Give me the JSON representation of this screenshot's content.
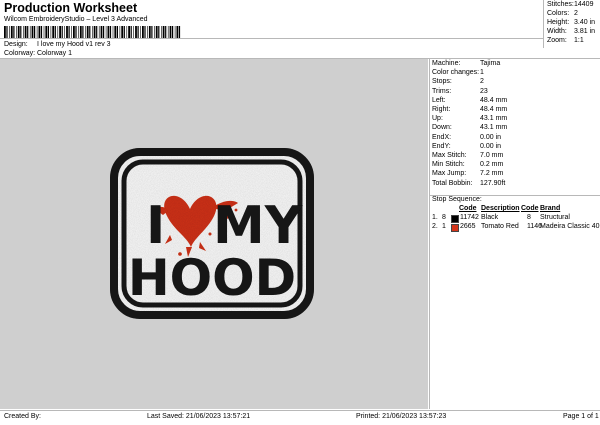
{
  "header": {
    "title": "Production Worksheet",
    "subtitle": "Wilcom EmbroideryStudio – Level 3 Advanced",
    "design_label": "Design:",
    "design_value": "I love my Hood v1 rev 3",
    "colorway_label": "Colorway:",
    "colorway_value": "Colorway 1"
  },
  "stats": [
    {
      "label": "Stitches:",
      "value": "14409"
    },
    {
      "label": "Colors:",
      "value": "2"
    },
    {
      "label": "Height:",
      "value": "3.40 in"
    },
    {
      "label": "Width:",
      "value": "3.81 in"
    },
    {
      "label": "Zoom:",
      "value": "1:1"
    }
  ],
  "machine_info": [
    {
      "label": "Machine:",
      "value": "Tajima"
    },
    {
      "label": "Color changes:",
      "value": "1"
    },
    {
      "label": "Stops:",
      "value": "2"
    },
    {
      "label": "Trims:",
      "value": "23"
    },
    {
      "label": "Left:",
      "value": "48.4 mm"
    },
    {
      "label": "Right:",
      "value": "48.4 mm"
    },
    {
      "label": "Up:",
      "value": "43.1 mm"
    },
    {
      "label": "Down:",
      "value": "43.1 mm"
    },
    {
      "label": "EndX:",
      "value": "0.00 in"
    },
    {
      "label": "EndY:",
      "value": "0.00 in"
    },
    {
      "label": "Max Stitch:",
      "value": "7.0 mm"
    },
    {
      "label": "Min Stitch:",
      "value": "0.2 mm"
    },
    {
      "label": "Max Jump:",
      "value": "7.2 mm"
    },
    {
      "label": "Total Bobbin:",
      "value": "127.90ft"
    }
  ],
  "stop_sequence": {
    "title": "Stop Sequence:",
    "columns": [
      "Code",
      "Description",
      "Code",
      "Brand"
    ],
    "rows": [
      {
        "num": "1.",
        "stop": "8",
        "color": "#000000",
        "code": "11742",
        "description": "Black",
        "brand_code": "8",
        "brand": "Structural"
      },
      {
        "num": "2.",
        "stop": "1",
        "color": "#d4341a",
        "code": "2665",
        "description": "Tomato Red",
        "brand_code": "1146",
        "brand": "Madeira Classic 40"
      }
    ]
  },
  "design": {
    "line1_left": "I",
    "line1_right": "MY",
    "line2": "HOOD",
    "thread_black": "#1a1a1a",
    "thread_red": "#d4341a"
  },
  "footer": {
    "created_by": "Created By:",
    "last_saved": "Last Saved: 21/06/2023 13:57:21",
    "printed": "Printed: 21/06/2023 13:57:23",
    "page": "Page 1 of 1"
  }
}
